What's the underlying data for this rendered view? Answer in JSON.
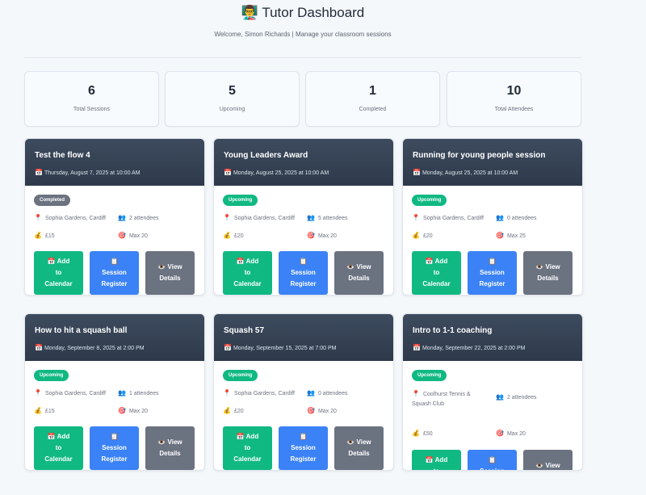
{
  "header": {
    "icon": "👨‍🏫",
    "title": "Tutor Dashboard",
    "subtitle": "Welcome, Simon Richards | Manage your classroom sessions"
  },
  "stats": [
    {
      "value": "6",
      "label": "Total Sessions"
    },
    {
      "value": "5",
      "label": "Upcoming"
    },
    {
      "value": "1",
      "label": "Completed"
    },
    {
      "value": "10",
      "label": "Total Attendees"
    }
  ],
  "icons": {
    "calendar": "📅",
    "location": "📍",
    "people": "👥",
    "money": "💰",
    "target": "🎯",
    "eye": "👁️",
    "clipboard": "📋"
  },
  "buttons": {
    "calendar_lines": [
      "Add",
      "to",
      "Calendar"
    ],
    "register_lines": [
      "Session",
      "Register"
    ],
    "details_lines": [
      "View",
      "Details"
    ]
  },
  "sessions": [
    {
      "title": "Test the flow 4",
      "date": "Thursday, August 7, 2025 at 10:00 AM",
      "status": "Completed",
      "location": "Sophia Gardens, Cardiff",
      "attendees": "2 attendees",
      "price": "£15",
      "max": "Max 20"
    },
    {
      "title": "Young Leaders Award",
      "date": "Monday, August 25, 2025 at 10:00 AM",
      "status": "Upcoming",
      "location": "Sophia Gardens, Cardiff",
      "attendees": "5 attendees",
      "price": "£20",
      "max": "Max 20"
    },
    {
      "title": "Running for young people session",
      "date": "Monday, August 25, 2025 at 10:00 AM",
      "status": "Upcoming",
      "location": "Sophia Gardens, Cardiff",
      "attendees": "0 attendees",
      "price": "£20",
      "max": "Max 25"
    },
    {
      "title": "How to hit a squash ball",
      "date": "Monday, September 8, 2025 at 2:00 PM",
      "status": "Upcoming",
      "location": "Sophia Gardens, Cardiff",
      "attendees": "1 attendees",
      "price": "£15",
      "max": "Max 20"
    },
    {
      "title": "Squash 57",
      "date": "Monday, September 15, 2025 at 7:00 PM",
      "status": "Upcoming",
      "location": "Sophia Gardens, Cardiff",
      "attendees": "0 attendees",
      "price": "£20",
      "max": "Max 20"
    },
    {
      "title": "Intro to 1-1 coaching",
      "date": "Monday, September 22, 2025 at 2:00 PM",
      "status": "Upcoming",
      "location": "Coolhurst Tennis & Squash Club",
      "attendees": "2 attendees",
      "price": "£50",
      "max": "Max 20"
    }
  ]
}
